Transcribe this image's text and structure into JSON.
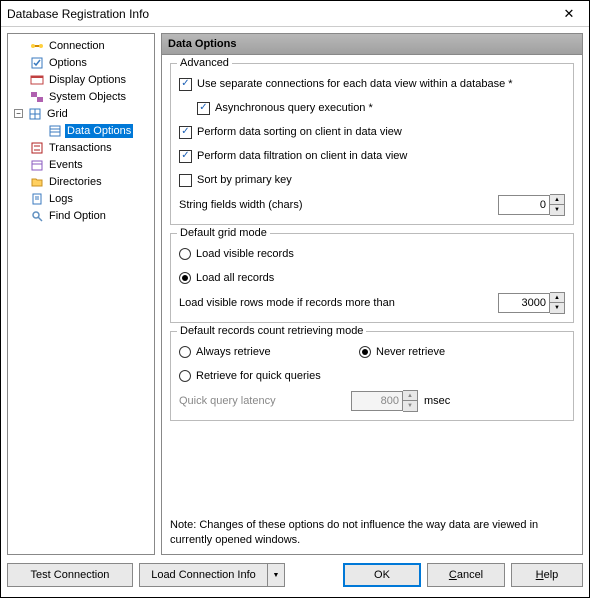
{
  "title": "Database Registration Info",
  "tree": {
    "connection": "Connection",
    "options": "Options",
    "display_options": "Display Options",
    "system_objects": "System Objects",
    "grid": "Grid",
    "data_options": "Data Options",
    "transactions": "Transactions",
    "events": "Events",
    "directories": "Directories",
    "logs": "Logs",
    "find_option": "Find Option"
  },
  "panel": {
    "header": "Data Options",
    "advanced": {
      "title": "Advanced",
      "separate_conn": "Use separate connections for each data view within a database *",
      "async_query": "Asynchronous query execution *",
      "perform_sort": "Perform data sorting on client in data view",
      "perform_filter": "Perform data filtration on client in data view",
      "sort_pk": "Sort by primary key",
      "string_width_label": "String fields width (chars)",
      "string_width_value": "0"
    },
    "default_grid": {
      "title": "Default grid mode",
      "load_visible": "Load visible records",
      "load_all": "Load all records",
      "rows_more_label": "Load visible rows mode if records more than",
      "rows_more_value": "3000"
    },
    "retrieve": {
      "title": "Default records count retrieving mode",
      "always": "Always retrieve",
      "never": "Never retrieve",
      "quick": "Retrieve for quick queries",
      "latency_label": "Quick query latency",
      "latency_value": "800",
      "latency_unit": "msec"
    },
    "note": "Note: Changes of these options do not influence the way data are viewed in currently opened windows."
  },
  "buttons": {
    "test": "Test Connection",
    "load": "Load Connection Info",
    "ok": "OK",
    "cancel": "Cancel",
    "help": "Help"
  }
}
